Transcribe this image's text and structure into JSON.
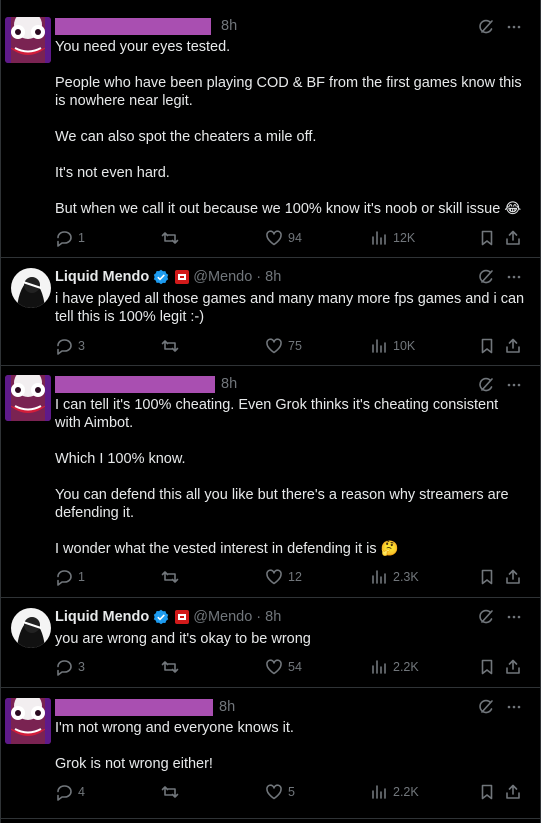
{
  "tweets": [
    {
      "time": "8h",
      "lines": [
        "You need your eyes tested.",
        "People who have been playing COD & BF from the first games know this is nowhere near legit.",
        "We can also spot the cheaters a mile off.",
        "It's not even hard.",
        "But when we call it out because we 100% know it's noob or skill issue 😂"
      ],
      "replies": "1",
      "reposts": "",
      "likes": "94",
      "views": "12K"
    },
    {
      "name": "Liquid Mendo",
      "handle": "@Mendo",
      "dot": "·",
      "time": "8h",
      "lines": [
        "i have played all those games and many many more fps games and i can tell this is 100% legit :-)"
      ],
      "replies": "3",
      "reposts": "",
      "likes": "75",
      "views": "10K"
    },
    {
      "time": "8h",
      "lines": [
        "I can tell it's 100% cheating. Even Grok thinks it's cheating consistent with Aimbot.",
        "Which I 100% know.",
        "You can defend this all you like but there's a reason why streamers are defending it.",
        "I wonder what the vested interest in defending it is 🤔"
      ],
      "replies": "1",
      "reposts": "",
      "likes": "12",
      "views": "2.3K"
    },
    {
      "name": "Liquid Mendo",
      "handle": "@Mendo",
      "dot": "·",
      "time": "8h",
      "lines": [
        "you are wrong and it's okay to be wrong"
      ],
      "replies": "3",
      "reposts": "",
      "likes": "54",
      "views": "2.2K"
    },
    {
      "time": "8h",
      "lines": [
        "I'm not wrong and everyone knows it.",
        "Grok is not wrong either!"
      ],
      "replies": "4",
      "reposts": "",
      "likes": "5",
      "views": "2.2K"
    }
  ],
  "colors": {
    "background": "#000000",
    "text": "#e7e9ea",
    "muted": "#71767b",
    "redaction": "#a94fb1",
    "verified": "#1d9bf0"
  },
  "icons": [
    "grok-icon",
    "more-icon",
    "reply-icon",
    "repost-icon",
    "like-icon",
    "views-icon",
    "bookmark-icon",
    "share-icon",
    "verified-icon",
    "flag-icon"
  ]
}
